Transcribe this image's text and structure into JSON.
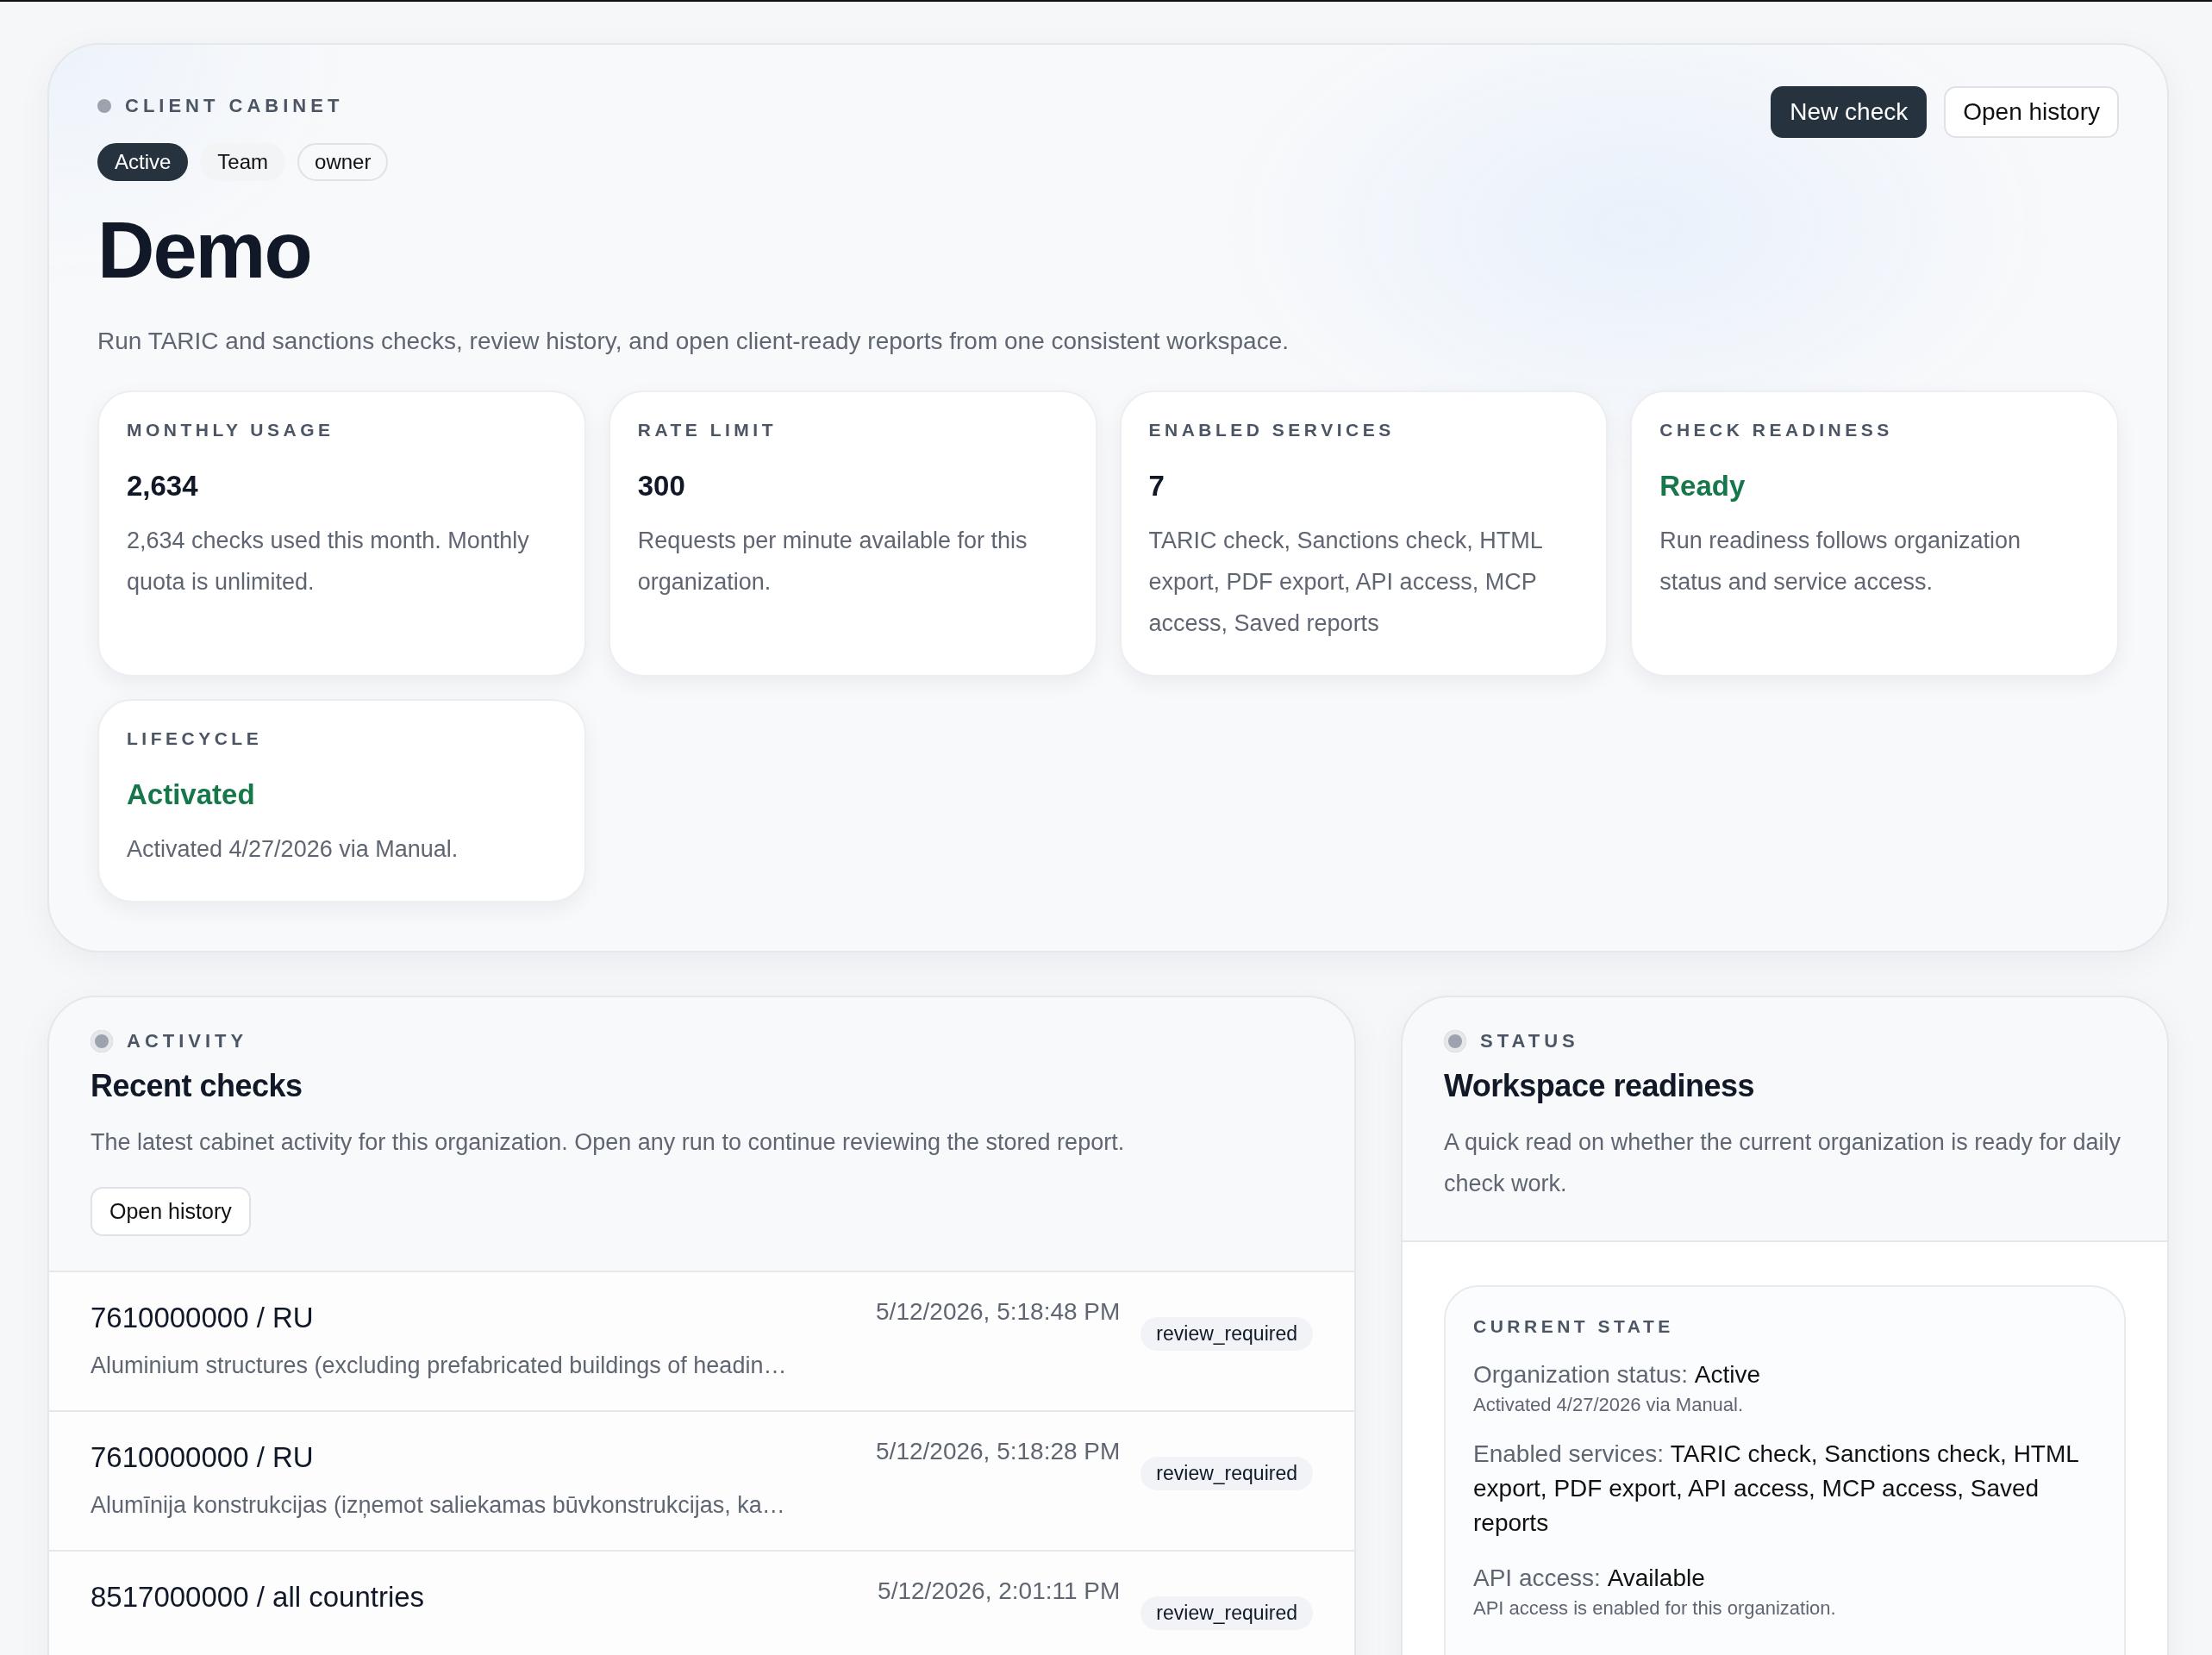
{
  "hero": {
    "eyebrow": "CLIENT CABINET",
    "tags": [
      {
        "label": "Active",
        "kind": "solid"
      },
      {
        "label": "Team",
        "kind": "soft"
      },
      {
        "label": "owner",
        "kind": "outline"
      }
    ],
    "title": "Demo",
    "description": "Run TARIC and sanctions checks, review history, and open client-ready reports from one consistent workspace.",
    "actions": [
      {
        "label": "New check",
        "kind": "primary"
      },
      {
        "label": "Open history",
        "kind": "secondary"
      }
    ],
    "stats": [
      {
        "label": "MONTHLY USAGE",
        "value": "2,634",
        "kind": "metric",
        "text": "2,634 checks used this month. Monthly quota is unlimited."
      },
      {
        "label": "RATE LIMIT",
        "value": "300",
        "kind": "metric",
        "text": "Requests per minute available for this organization."
      },
      {
        "label": "ENABLED SERVICES",
        "value": "7",
        "kind": "metric",
        "text": "TARIC check, Sanctions check, HTML export, PDF export, API access, MCP access, Saved reports"
      },
      {
        "label": "CHECK READINESS",
        "value": "Ready",
        "kind": "status",
        "text": "Run readiness follows organization status and service access."
      },
      {
        "label": "LIFECYCLE",
        "value": "Activated",
        "kind": "status",
        "text": "Activated 4/27/2026 via Manual."
      }
    ]
  },
  "activity": {
    "eyebrow": "ACTIVITY",
    "title": "Recent checks",
    "description": "The latest cabinet activity for this organization. Open any run to continue reviewing the stored report.",
    "button": "Open history",
    "rows": [
      {
        "title": "7610000000 / RU",
        "subtitle": "Aluminium structures (excluding prefabricated buildings of headin…",
        "time": "5/12/2026, 5:18:48 PM",
        "status": "review_required"
      },
      {
        "title": "7610000000 / RU",
        "subtitle": "Alumīnija konstrukcijas (izņemot saliekamas būvkonstrukcijas, ka…",
        "time": "5/12/2026, 5:18:28 PM",
        "status": "review_required"
      },
      {
        "title": "8517000000 / all countries",
        "time": "5/12/2026, 2:01:11 PM",
        "status": "review_required"
      }
    ]
  },
  "status": {
    "eyebrow": "STATUS",
    "title": "Workspace readiness",
    "description": "A quick read on whether the current organization is ready for daily check work.",
    "card_label": "CURRENT STATE",
    "items": [
      {
        "label": "Organization status:",
        "value": "Active",
        "note": "Activated 4/27/2026 via Manual."
      },
      {
        "label": "Enabled services:",
        "value": "TARIC check, Sanctions check, HTML export, PDF export, API access, MCP access, Saved reports"
      },
      {
        "label": "API access:",
        "value": "Available",
        "note": "API access is enabled for this organization."
      }
    ]
  }
}
